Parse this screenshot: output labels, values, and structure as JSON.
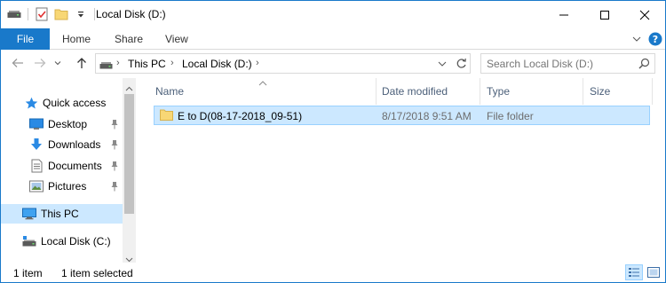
{
  "window": {
    "title": "Local Disk (D:)"
  },
  "ribbon": {
    "tabs": [
      "File",
      "Home",
      "Share",
      "View"
    ]
  },
  "address": {
    "crumbs": [
      "This PC",
      "Local Disk (D:)"
    ],
    "search_placeholder": "Search Local Disk (D:)"
  },
  "nav": {
    "quick_access": "Quick access",
    "items": [
      {
        "label": "Desktop",
        "icon": "desktop-icon",
        "pinned": true
      },
      {
        "label": "Downloads",
        "icon": "download-arrow-icon",
        "pinned": true
      },
      {
        "label": "Documents",
        "icon": "documents-icon",
        "pinned": true
      },
      {
        "label": "Pictures",
        "icon": "pictures-icon",
        "pinned": true
      }
    ],
    "this_pc": "This PC",
    "local_disk_c": "Local Disk (C:)"
  },
  "columns": {
    "name": "Name",
    "date_modified": "Date modified",
    "type": "Type",
    "size": "Size"
  },
  "files": [
    {
      "name": "E to D(08-17-2018_09-51)",
      "date_modified": "8/17/2018 9:51 AM",
      "type": "File folder",
      "size": ""
    }
  ],
  "status": {
    "count": "1 item",
    "selected": "1 item selected"
  },
  "colors": {
    "accent": "#1979ca",
    "selection": "#cce8ff",
    "selection_border": "#99d1ff",
    "header_text": "#4c607a",
    "folder": "#f8d775"
  }
}
